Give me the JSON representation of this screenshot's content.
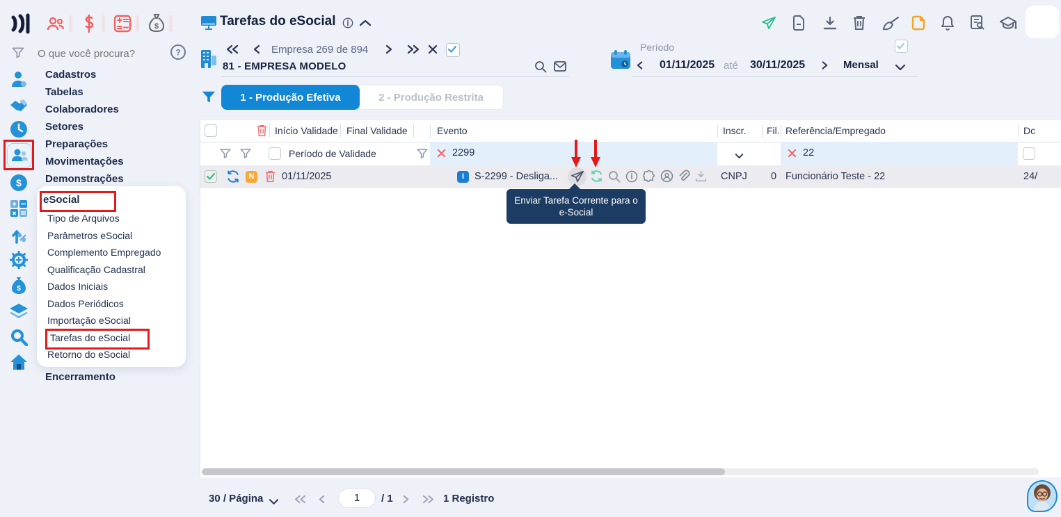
{
  "search": {
    "placeholder": "O que você procura?"
  },
  "menu": {
    "items": [
      "Cadastros",
      "Tabelas",
      "Colaboradores",
      "Setores",
      "Preparações",
      "Movimentações",
      "Demonstrações"
    ],
    "esocial": "eSocial",
    "submenu": [
      "Tipo de Arquivos",
      "Parâmetros eSocial",
      "Complemento Empregado",
      "Qualificação Cadastral",
      "Dados Iniciais",
      "Dados Periódicos",
      "Importação eSocial",
      "Tarefas do eSocial",
      "Retorno do eSocial"
    ],
    "closing": "Encerramento"
  },
  "header": {
    "title": "Tarefas do eSocial"
  },
  "toolbar": {
    "icons": [
      "send-icon",
      "file-icon",
      "download-icon",
      "trash-icon",
      "broom-icon",
      "note-icon",
      "bell-icon",
      "doc-search-icon",
      "graduation-icon"
    ]
  },
  "company": {
    "position": "Empresa 269 de 894",
    "name": "81 - EMPRESA MODELO"
  },
  "period": {
    "label": "Período",
    "start": "01/11/2025",
    "conj": "até",
    "end": "30/11/2025",
    "mode": "Mensal"
  },
  "tabs": {
    "active": "1 - Produção Efetiva",
    "inactive": "2 - Produção Restrita"
  },
  "grid": {
    "headers": {
      "inicio": "Início Validade",
      "final": "Final Validade",
      "evento": "Evento",
      "inscr": "Inscr.",
      "fil": "Fil.",
      "referencia": "Referência/Empregado",
      "doc": "Dc"
    },
    "filters": {
      "periodo": "Período de Validade",
      "evento": "2299",
      "referencia": "22"
    },
    "row": {
      "date": "01/11/2025",
      "badge_n": "N",
      "badge_i": "I",
      "evento": "S-2299 - Desliga...",
      "inscr": "CNPJ",
      "fil": "0",
      "referencia": "Funcionário Teste - 22",
      "doc": "24/"
    }
  },
  "tooltip": {
    "line1": "Enviar Tarefa Corrente para o",
    "line2": "e-Social"
  },
  "pagination": {
    "per_page": "30 / Página",
    "page": "1",
    "of": "/ 1",
    "records": "1 Registro"
  },
  "colors": {
    "accent": "#1187d6",
    "annotation_red": "#e11b1b",
    "green": "#2fbf8f",
    "orange_badge": "#f5a93b",
    "tooltip_bg": "#1d3c63"
  }
}
